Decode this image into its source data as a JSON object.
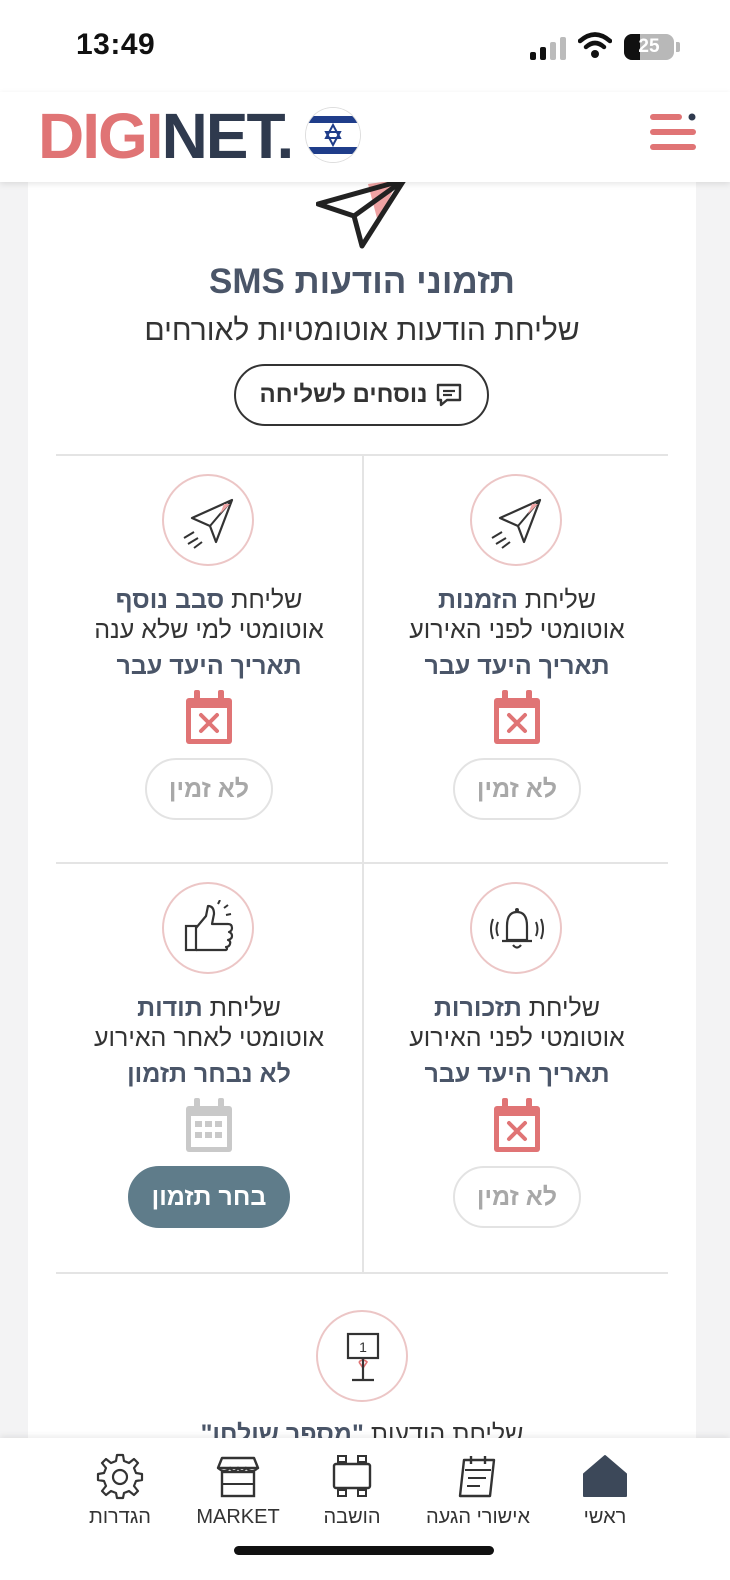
{
  "status_bar": {
    "time": "13:49",
    "battery": "25"
  },
  "header": {
    "logo_part1": "DIGI",
    "logo_part2": "NET.",
    "menu_icon": "hamburger-menu-icon"
  },
  "sms": {
    "title": "תזמוני הודעות SMS",
    "subtitle": "שליחת הודעות אוטומטיות לאורחים",
    "templates_button": "נוסחים לשליחה",
    "cells": [
      {
        "prefix": "שליחת ",
        "bold": "הזמנות",
        "line2": "אוטומטי לפני האירוע",
        "status": "תאריך היעד עבר",
        "button": "לא זמין",
        "icon": "paper-plane-icon",
        "calendar_icon": "calendar-x-icon"
      },
      {
        "prefix": "שליחת ",
        "bold": "סבב נוסף",
        "line2": "אוטומטי למי שלא ענה",
        "status": "תאריך היעד עבר",
        "button": "לא זמין",
        "icon": "paper-plane-icon",
        "calendar_icon": "calendar-x-icon"
      },
      {
        "prefix": "שליחת ",
        "bold": "תזכורות",
        "line2": "אוטומטי לפני האירוע",
        "status": "תאריך היעד עבר",
        "button": "לא זמין",
        "icon": "bell-icon",
        "calendar_icon": "calendar-x-icon"
      },
      {
        "prefix": "שליחת ",
        "bold": "תודות",
        "line2": "אוטומטי לאחר האירוע",
        "status": "לא נבחר תזמון",
        "button": "בחר תזמון",
        "icon": "thumbs-up-icon",
        "calendar_icon": "calendar-grid-icon"
      }
    ],
    "partial_text_prefix": "שליחת הודעות ",
    "partial_text_bold": "\"מספר שולחן\"",
    "table_icon": "table-number-icon"
  },
  "colors": {
    "accent": "#e07475",
    "brand_dark": "#2f3a4e",
    "button_active": "#5f7c8a"
  },
  "bottom_nav": [
    {
      "label": "ראשי",
      "icon": "home-icon"
    },
    {
      "label": "אישורי הגעה",
      "icon": "clipboard-check-icon"
    },
    {
      "label": "הושבה",
      "icon": "table-seating-icon"
    },
    {
      "label": "MARKET",
      "icon": "store-icon"
    },
    {
      "label": "הגדרות",
      "icon": "gear-icon"
    }
  ]
}
